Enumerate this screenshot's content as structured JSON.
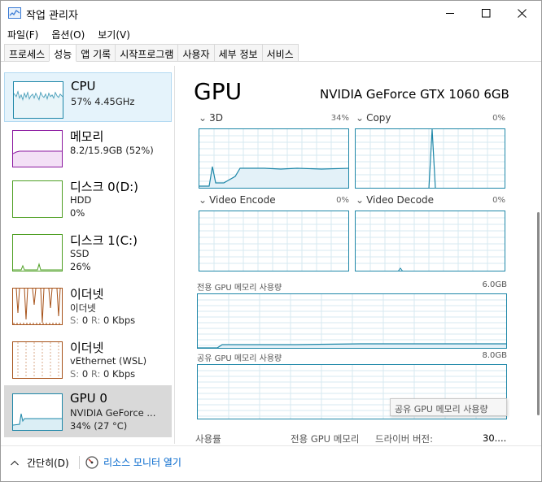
{
  "window": {
    "title": "작업 관리자"
  },
  "menu": [
    "파일(F)",
    "옵션(O)",
    "보기(V)"
  ],
  "tabs": [
    "프로세스",
    "성능",
    "앱 기록",
    "시작프로그램",
    "사용자",
    "세부 정보",
    "서비스"
  ],
  "active_tab": "성능",
  "sidebar": [
    {
      "name": "CPU",
      "line1": "57%  4.45GHz",
      "line2": "",
      "color": "#1e87a8"
    },
    {
      "name": "메모리",
      "line1": "8.2/15.9GB (52%)",
      "line2": "",
      "color": "#8b18a0"
    },
    {
      "name": "디스크 0(D:)",
      "line1": "HDD",
      "line2": "0%",
      "color": "#4fa024"
    },
    {
      "name": "디스크 1(C:)",
      "line1": "SSD",
      "line2": "26%",
      "color": "#4fa024"
    },
    {
      "name": "이더넷",
      "line1": "이더넷",
      "line2_s": "S:",
      "line2_v": "0",
      "line2_r": "R:",
      "line2_rv": "0 Kbps",
      "color": "#a7531a"
    },
    {
      "name": "이더넷",
      "line1": "vEthernet (WSL)",
      "line2_s": "S:",
      "line2_v": "0",
      "line2_r": "R:",
      "line2_rv": "0 Kbps",
      "color": "#a7531a"
    },
    {
      "name": "GPU 0",
      "line1": "NVIDIA GeForce ...",
      "line2": "34% (27 °C)",
      "color": "#1e87a8"
    }
  ],
  "detail": {
    "title": "GPU",
    "model": "NVIDIA GeForce GTX 1060 6GB",
    "engines": [
      {
        "label": "3D",
        "pct": "34%"
      },
      {
        "label": "Copy",
        "pct": "0%"
      },
      {
        "label": "Video Encode",
        "pct": "0%"
      },
      {
        "label": "Video Decode",
        "pct": "0%"
      }
    ],
    "dedicated": {
      "label": "전용 GPU 메모리 사용량",
      "max": "6.0GB"
    },
    "shared": {
      "label": "공유 GPU 메모리 사용량",
      "max": "8.0GB"
    },
    "tooltip": "공유 GPU 메모리 사용량",
    "stats": {
      "utilization": "사용률",
      "dedicated_mem": "전용 GPU 메모리",
      "driver_version": "드라이버 버전:",
      "driver_value": "30...."
    }
  },
  "footer": {
    "fewer_details": "간단히(D)",
    "resource_monitor": "리소스 모니터 열기"
  },
  "colors": {
    "accent": "#1e87a8",
    "link": "#0066cc"
  }
}
